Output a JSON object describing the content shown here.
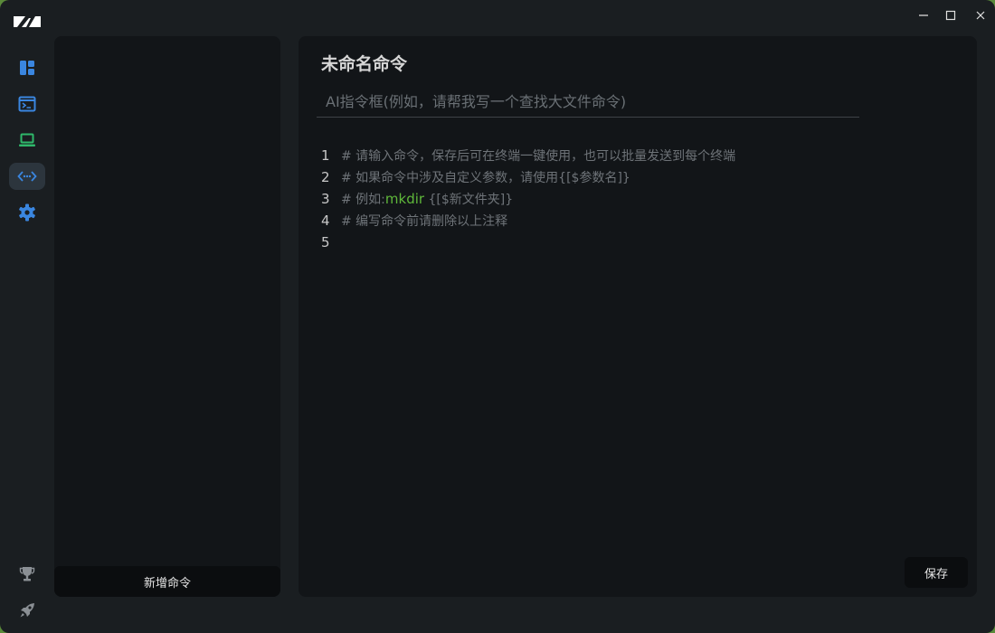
{
  "app": {
    "logo": "app-logo"
  },
  "window_controls": [
    "minimize-icon",
    "maximize-icon",
    "close-icon"
  ],
  "sidebar": {
    "items": [
      {
        "icon": "dashboard-icon",
        "active": false
      },
      {
        "icon": "terminal-icon",
        "active": false
      },
      {
        "icon": "laptop-icon",
        "active": false
      },
      {
        "icon": "code-icon",
        "active": true
      },
      {
        "icon": "gear-icon",
        "active": false
      }
    ],
    "bottom": [
      {
        "icon": "trophy-icon"
      },
      {
        "icon": "rocket-icon"
      }
    ]
  },
  "command_list": {
    "add_label": "新增命令"
  },
  "editor": {
    "title": "未命名命令",
    "ai_placeholder": "AI指令框(例如，请帮我写一个查找大文件命令)",
    "lines": [
      {
        "num": "1",
        "text": "# 请输入命令，保存后可在终端一键使用，也可以批量发送到每个终端"
      },
      {
        "num": "2",
        "text": "# 如果命令中涉及自定义参数，请使用{[$参数名]}"
      },
      {
        "num": "3",
        "prefix": "# 例如:",
        "keyword": "mkdir",
        "suffix": " {[$新文件夹]}"
      },
      {
        "num": "4",
        "text": "# 编写命令前请删除以上注释"
      },
      {
        "num": "5",
        "text": ""
      }
    ],
    "save_label": "保存"
  },
  "colors": {
    "accent_blue": "#3a86e0",
    "accent_green": "#2fb86a",
    "keyword_green": "#5fb83a"
  }
}
